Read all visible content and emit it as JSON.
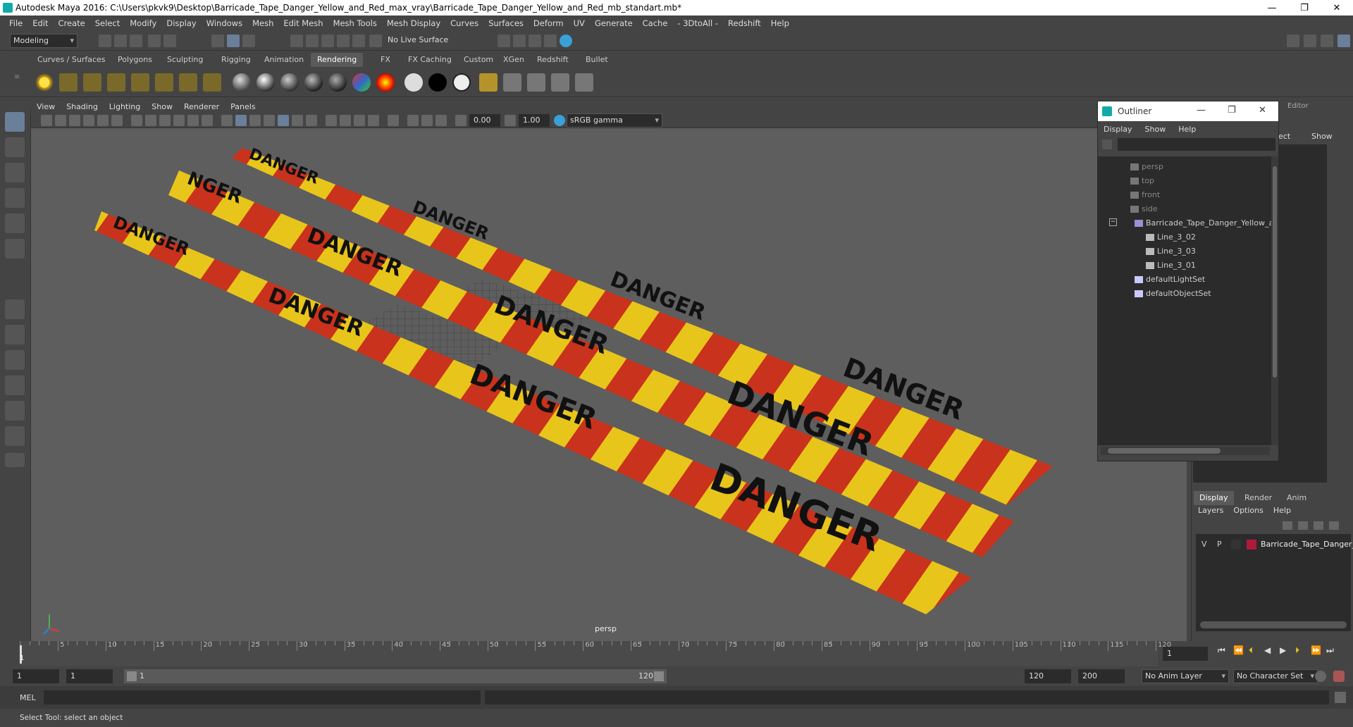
{
  "window": {
    "title": "Autodesk Maya 2016: C:\\Users\\pkvk9\\Desktop\\Barricade_Tape_Danger_Yellow_and_Red_max_vray\\Barricade_Tape_Danger_Yellow_and_Red_mb_standart.mb*",
    "buttons": [
      "—",
      "❐",
      "✕"
    ]
  },
  "menubar": [
    "File",
    "Edit",
    "Create",
    "Select",
    "Modify",
    "Display",
    "Windows",
    "Mesh",
    "Edit Mesh",
    "Mesh Tools",
    "Mesh Display",
    "Curves",
    "Surfaces",
    "Deform",
    "UV",
    "Generate",
    "Cache",
    "- 3DtoAll -",
    "Redshift",
    "Help"
  ],
  "statusline": {
    "mode": "Modeling",
    "live_surface": "No Live Surface"
  },
  "shelf_tabs": [
    "Curves / Surfaces",
    "Polygons",
    "Sculpting",
    "Rigging",
    "Animation",
    "Rendering",
    "FX",
    "FX Caching",
    "Custom",
    "XGen",
    "Redshift",
    "Bullet"
  ],
  "shelf_active": "Rendering",
  "viewport": {
    "menu": [
      "View",
      "Shading",
      "Lighting",
      "Show",
      "Renderer",
      "Panels"
    ],
    "exposure": "0.00",
    "gamma": "1.00",
    "colorspace": "sRGB gamma",
    "camera_label": "persp",
    "tape_text": "DANGER",
    "tape_text_partial": "NGER",
    "colors": {
      "yellow": "#e8c51a",
      "red": "#c9321c",
      "bg": "#5e5e5e"
    }
  },
  "outliner": {
    "title": "Outliner",
    "menu": [
      "Display",
      "Show",
      "Help"
    ],
    "items": [
      {
        "label": "persp",
        "dim": true,
        "icon": "camera-icon"
      },
      {
        "label": "top",
        "dim": true,
        "icon": "camera-icon"
      },
      {
        "label": "front",
        "dim": true,
        "icon": "camera-icon"
      },
      {
        "label": "side",
        "dim": true,
        "icon": "camera-icon"
      },
      {
        "label": "Barricade_Tape_Danger_Yellow_an",
        "dim": false,
        "icon": "group-icon"
      },
      {
        "label": "Line_3_02",
        "dim": false,
        "icon": "mesh-icon"
      },
      {
        "label": "Line_3_03",
        "dim": false,
        "icon": "mesh-icon"
      },
      {
        "label": "Line_3_01",
        "dim": false,
        "icon": "mesh-icon"
      },
      {
        "label": "defaultLightSet",
        "dim": false,
        "icon": "set-icon"
      },
      {
        "label": "defaultObjectSet",
        "dim": false,
        "icon": "set-icon"
      }
    ]
  },
  "right_panel": {
    "editor_label": "Editor",
    "partial_menu": [
      "ject",
      "Show"
    ],
    "layer_tabs": [
      "Display",
      "Render",
      "Anim"
    ],
    "layer_menu": [
      "Layers",
      "Options",
      "Help"
    ],
    "layer_row": {
      "v": "V",
      "p": "P",
      "name": "Barricade_Tape_Danger_",
      "color": "#b0193a"
    }
  },
  "timeline": {
    "labels": [
      "5",
      "10",
      "15",
      "20",
      "25",
      "30",
      "35",
      "40",
      "45",
      "50",
      "55",
      "60",
      "65",
      "70",
      "75",
      "80",
      "85",
      "90",
      "95",
      "100",
      "105",
      "110",
      "115",
      "120"
    ],
    "current": "1",
    "current_field": "1"
  },
  "range": {
    "start": "1",
    "start2": "1",
    "slider_start": "1",
    "slider_end": "120",
    "end": "120",
    "end2": "200",
    "anim_layer": "No Anim Layer",
    "char_set": "No Character Set"
  },
  "cmd": {
    "lang": "MEL"
  },
  "help": {
    "text": "Select Tool: select an object"
  }
}
